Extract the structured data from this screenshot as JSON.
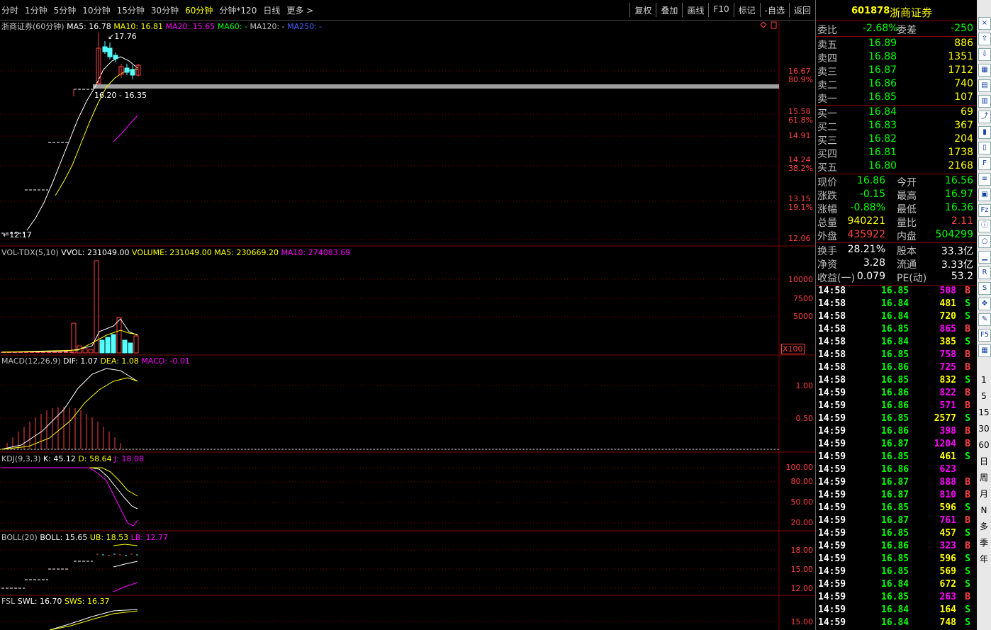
{
  "toolbar": {
    "periods": [
      "分时",
      "1分钟",
      "5分钟",
      "10分钟",
      "15分钟",
      "30分钟",
      "60分钟",
      "分钟*120",
      "日线",
      "更多 >"
    ],
    "active_period": "60分钟",
    "tools": [
      "复权",
      "叠加",
      "画线",
      "F10",
      "标记",
      "-自选",
      "返回"
    ]
  },
  "header": {
    "code": "601878",
    "name": "浙商证券"
  },
  "panels": {
    "main": {
      "title": "浙商证券(60分钟)",
      "ma5": "MA5: 16.78",
      "ma10": "MA10: 16.81",
      "ma20": "MA20: 15.65",
      "ma60": "MA60: -",
      "ma120": "MA120: -",
      "ma250": "MA250: -",
      "high_label": "17.76",
      "low_label": "12.17",
      "range_label": "16.20 - 16.35",
      "axis": [
        {
          "v": "16.67",
          "p": "80.9%"
        },
        {
          "v": "15.58",
          "p": "61.8%"
        },
        {
          "v": "14.91",
          "p": ""
        },
        {
          "v": "14.24",
          "p": "38.2%"
        },
        {
          "v": "13.15",
          "p": "19.1%"
        },
        {
          "v": "12.06",
          "p": ""
        }
      ]
    },
    "vol": {
      "name": "VOL-TDX(5,10)",
      "vvol": "VVOL: 231049.00",
      "volume": "VOLUME: 231049.00",
      "ma5": "MA5: 230669.20",
      "ma10": "MA10: 274083.69",
      "axis": [
        "10000",
        "7500",
        "5000"
      ],
      "unit": "X100"
    },
    "macd": {
      "name": "MACD(12,26,9)",
      "dif": "DIF: 1.07",
      "dea": "DEA: 1.08",
      "macd": "MACD: -0.01",
      "axis": [
        "1.00",
        "0.50"
      ]
    },
    "kdj": {
      "name": "KDJ(9,3,3)",
      "k": "K: 45.12",
      "d": "D: 58.64",
      "j": "J: 18.08",
      "axis": [
        "100.00",
        "80.00",
        "50.00",
        "20.00"
      ]
    },
    "boll": {
      "name": "BOLL(20)",
      "boll": "BOLL: 15.65",
      "ub": "UB: 18.53",
      "lb": "LB: 12.77",
      "axis": [
        "18.00",
        "15.00",
        "12.00"
      ]
    },
    "fsl": {
      "name": "FSL",
      "swl": "SWL: 16.70",
      "sws": "SWS: 16.37",
      "axis": [
        "15.00"
      ]
    }
  },
  "quote": {
    "weibi": {
      "label": "委比",
      "value": "-2.68%",
      "label2": "委差",
      "value2": "-250"
    },
    "asks": [
      {
        "label": "卖五",
        "price": "16.89",
        "vol": "886"
      },
      {
        "label": "卖四",
        "price": "16.88",
        "vol": "1351"
      },
      {
        "label": "卖三",
        "price": "16.87",
        "vol": "1712"
      },
      {
        "label": "卖二",
        "price": "16.86",
        "vol": "740"
      },
      {
        "label": "卖一",
        "price": "16.85",
        "vol": "107"
      }
    ],
    "bids": [
      {
        "label": "买一",
        "price": "16.84",
        "vol": "69"
      },
      {
        "label": "买二",
        "price": "16.83",
        "vol": "367"
      },
      {
        "label": "买三",
        "price": "16.82",
        "vol": "204"
      },
      {
        "label": "买四",
        "price": "16.81",
        "vol": "1738"
      },
      {
        "label": "买五",
        "price": "16.80",
        "vol": "2168"
      }
    ],
    "stats": [
      {
        "l1": "现价",
        "v1": "16.86",
        "c1": "#00ff00",
        "l2": "今开",
        "v2": "16.56",
        "c2": "#00ff00"
      },
      {
        "l1": "涨跌",
        "v1": "-0.15",
        "c1": "#00ff00",
        "l2": "最高",
        "v2": "16.97",
        "c2": "#00ff00"
      },
      {
        "l1": "涨幅",
        "v1": "-0.88%",
        "c1": "#00ff00",
        "l2": "最低",
        "v2": "16.36",
        "c2": "#00ff00"
      },
      {
        "l1": "总量",
        "v1": "940221",
        "c1": "#ffff00",
        "l2": "量比",
        "v2": "2.11",
        "c2": "#ff4040"
      },
      {
        "l1": "外盘",
        "v1": "435922",
        "c1": "#ff4040",
        "l2": "内盘",
        "v2": "504299",
        "c2": "#00ff00"
      }
    ],
    "info": [
      {
        "l1": "换手",
        "v1": "28.21%",
        "l2": "股本",
        "v2": "33.3亿"
      },
      {
        "l1": "净资",
        "v1": "3.28",
        "l2": "流通",
        "v2": "3.33亿"
      },
      {
        "l1": "收益(一)",
        "v1": "0.079",
        "l2": "PE(动)",
        "v2": "53.2"
      }
    ]
  },
  "ticks": [
    {
      "t": "14:58",
      "p": "16.85",
      "v": "508",
      "s": "B"
    },
    {
      "t": "14:58",
      "p": "16.84",
      "v": "481",
      "s": "S"
    },
    {
      "t": "14:58",
      "p": "16.84",
      "v": "720",
      "s": "S"
    },
    {
      "t": "14:58",
      "p": "16.85",
      "v": "865",
      "s": "B"
    },
    {
      "t": "14:58",
      "p": "16.84",
      "v": "385",
      "s": "S"
    },
    {
      "t": "14:58",
      "p": "16.85",
      "v": "758",
      "s": "B"
    },
    {
      "t": "14:58",
      "p": "16.86",
      "v": "725",
      "s": "B"
    },
    {
      "t": "14:58",
      "p": "16.85",
      "v": "832",
      "s": "S"
    },
    {
      "t": "14:59",
      "p": "16.86",
      "v": "822",
      "s": "B"
    },
    {
      "t": "14:59",
      "p": "16.86",
      "v": "571",
      "s": "B"
    },
    {
      "t": "14:59",
      "p": "16.85",
      "v": "2577",
      "s": "S"
    },
    {
      "t": "14:59",
      "p": "16.86",
      "v": "398",
      "s": "B"
    },
    {
      "t": "14:59",
      "p": "16.87",
      "v": "1204",
      "s": "B"
    },
    {
      "t": "14:59",
      "p": "16.85",
      "v": "461",
      "s": "S"
    },
    {
      "t": "14:59",
      "p": "16.86",
      "v": "623",
      "s": ""
    },
    {
      "t": "14:59",
      "p": "16.87",
      "v": "888",
      "s": "B"
    },
    {
      "t": "14:59",
      "p": "16.87",
      "v": "810",
      "s": "B"
    },
    {
      "t": "14:59",
      "p": "16.85",
      "v": "596",
      "s": "S"
    },
    {
      "t": "14:59",
      "p": "16.87",
      "v": "761",
      "s": "B"
    },
    {
      "t": "14:59",
      "p": "16.85",
      "v": "457",
      "s": "S"
    },
    {
      "t": "14:59",
      "p": "16.86",
      "v": "323",
      "s": "B"
    },
    {
      "t": "14:59",
      "p": "16.85",
      "v": "596",
      "s": "S"
    },
    {
      "t": "14:59",
      "p": "16.85",
      "v": "569",
      "s": "S"
    },
    {
      "t": "14:59",
      "p": "16.84",
      "v": "672",
      "s": "S"
    },
    {
      "t": "14:59",
      "p": "16.85",
      "v": "263",
      "s": "B"
    },
    {
      "t": "14:59",
      "p": "16.84",
      "v": "164",
      "s": "S"
    },
    {
      "t": "14:59",
      "p": "16.84",
      "v": "748",
      "s": "S"
    }
  ],
  "side_icons": [
    "x-icon",
    "up-icon",
    "down-icon",
    "chart-icon",
    "table-icon",
    "list-icon",
    "trend-icon",
    "candle-icon",
    "doc-icon",
    "f10-icon",
    "note-icon",
    "book-icon",
    "fz-icon",
    "info-icon",
    "circle-icon",
    "bar-icon",
    "rsi-icon",
    "s-icon",
    "move-icon",
    "pen-icon",
    "f5-icon",
    "grid-icon"
  ],
  "side_periods": [
    "1",
    "5",
    "15",
    "30",
    "60",
    "日",
    "周",
    "月",
    "N",
    "多",
    "季",
    "年"
  ],
  "colors": {
    "up": "#ff4040",
    "down": "#54ffff",
    "ma5": "#ffffff",
    "ma10": "#ffff00",
    "ma20": "#ff00ff",
    "grid": "#800000"
  }
}
